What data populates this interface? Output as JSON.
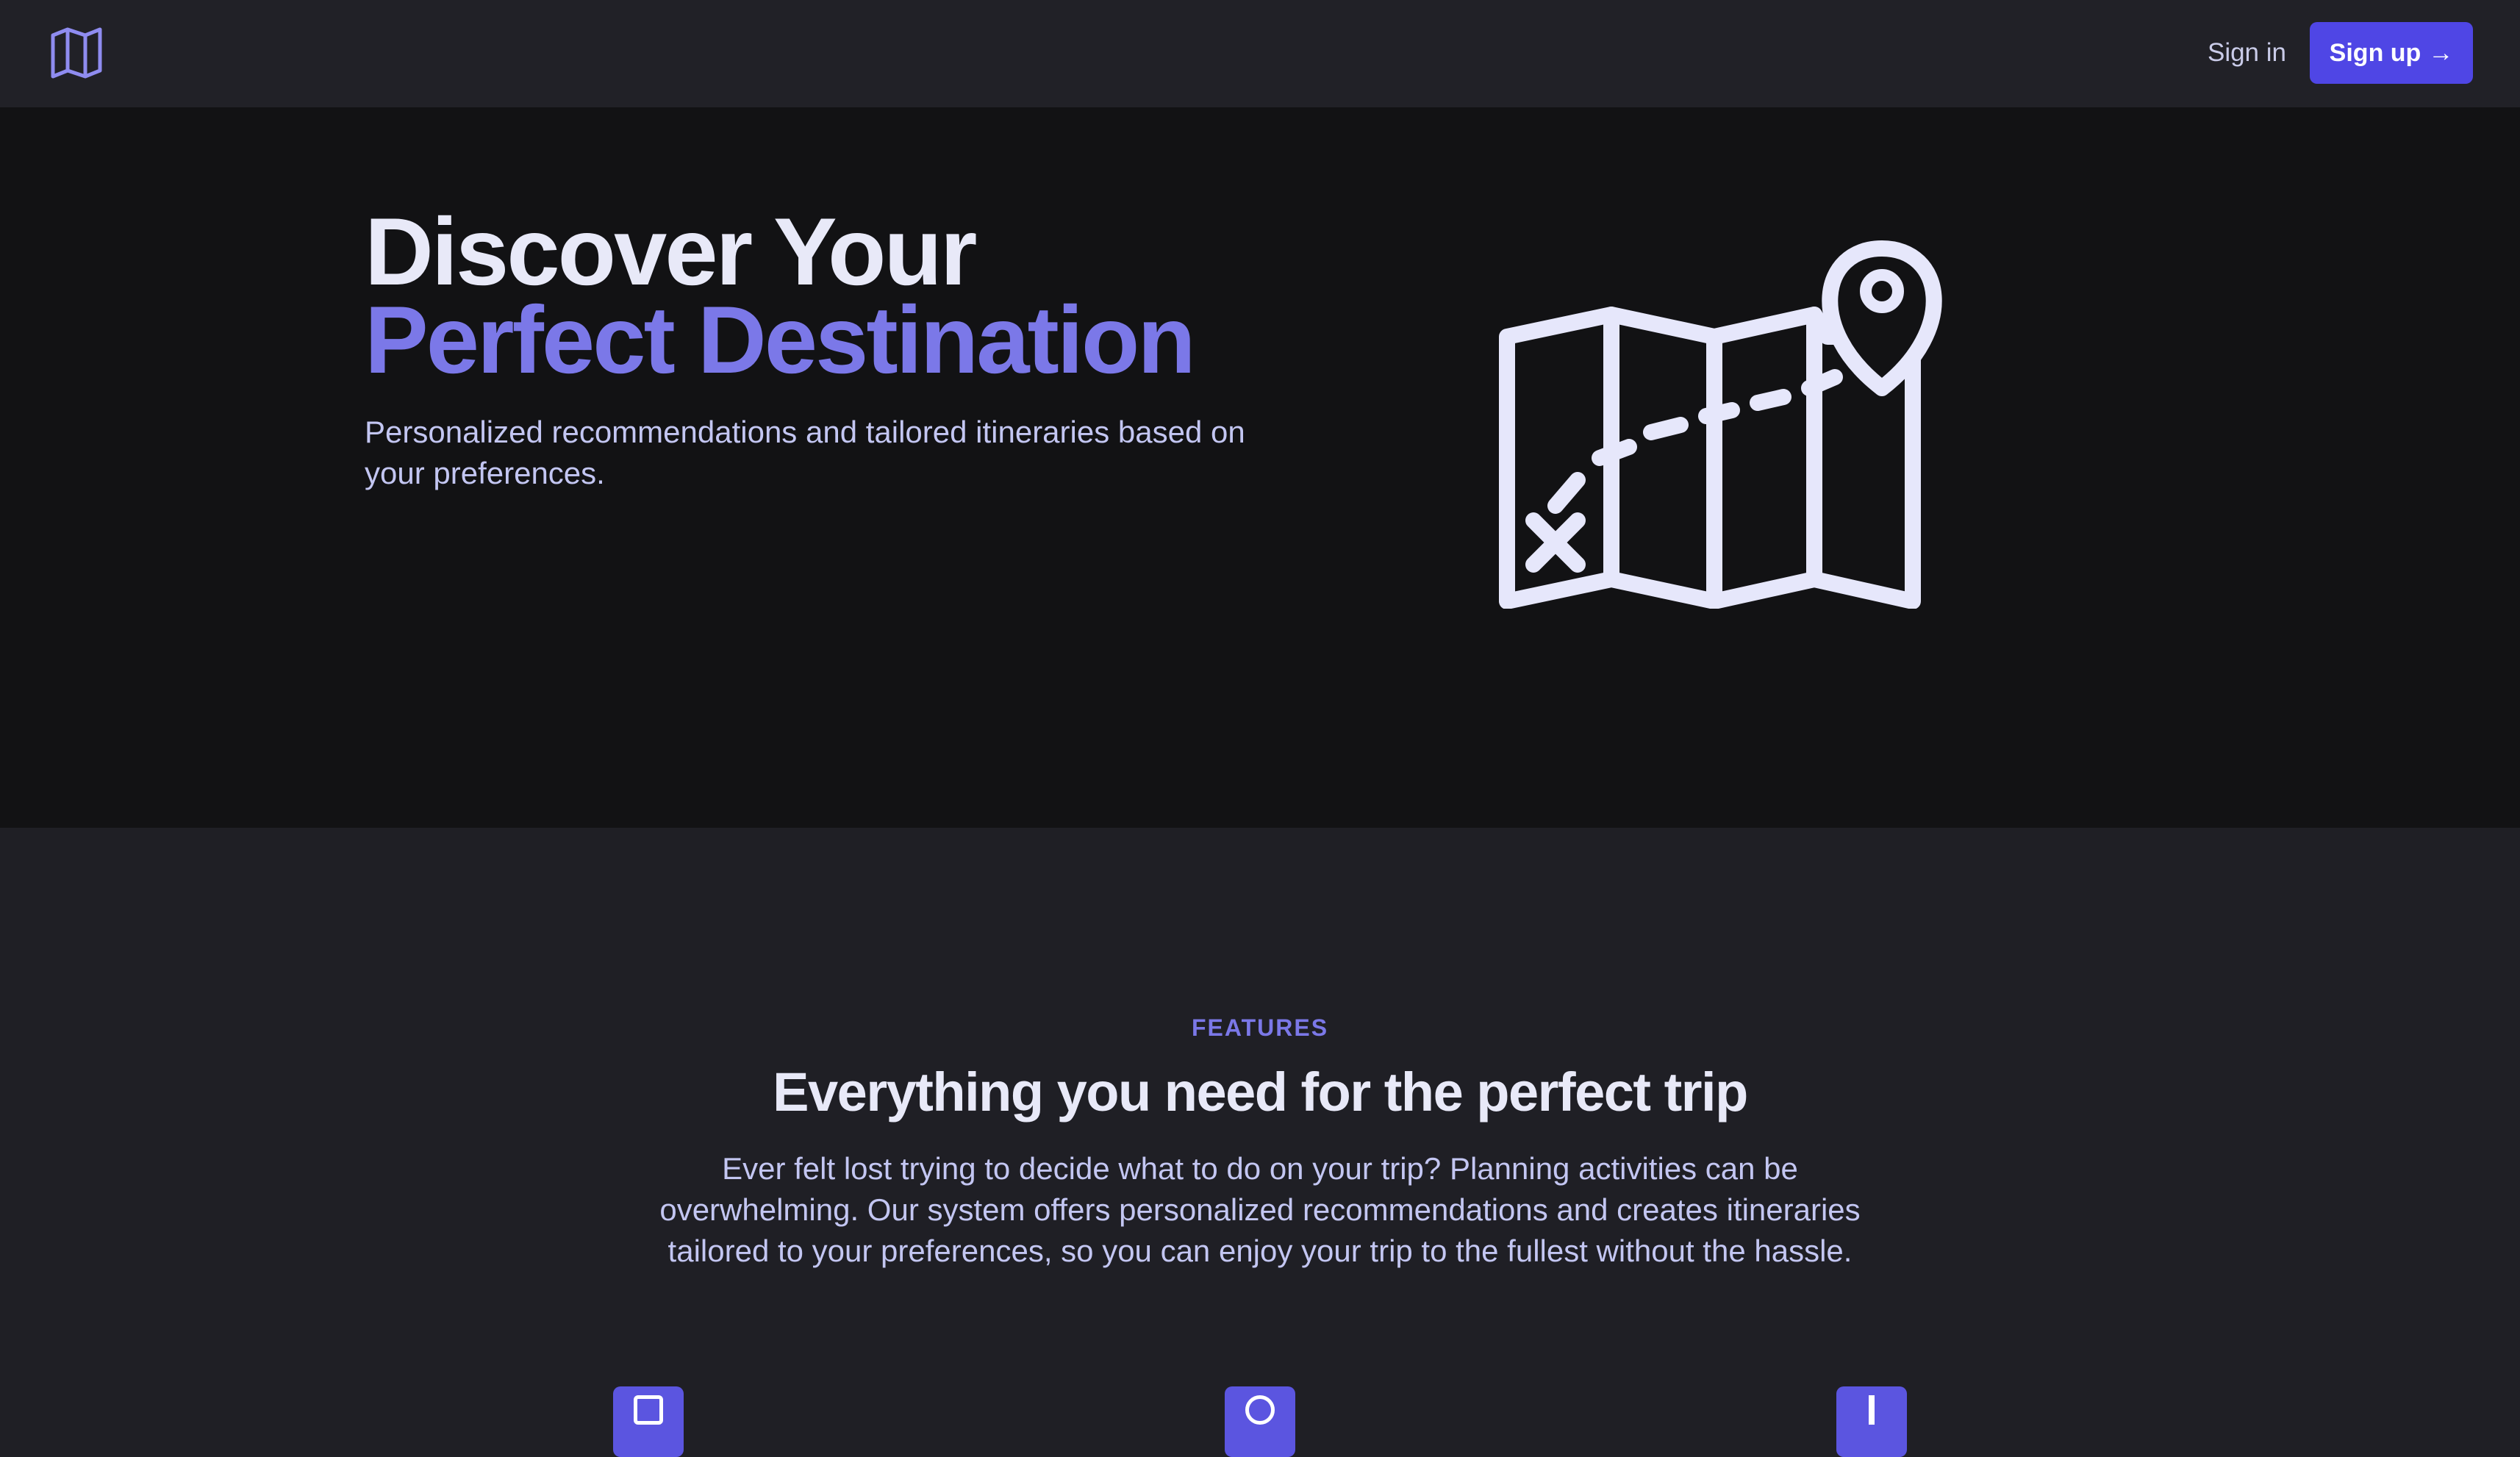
{
  "nav": {
    "logo_icon": "folded-map-icon",
    "signin_label": "Sign in",
    "signup_label": "Sign up",
    "signup_arrow": "→"
  },
  "hero": {
    "title_line1": "Discover Your",
    "title_line2": "Perfect Destination",
    "subtitle": "Personalized recommendations and tailored itineraries based on your preferences.",
    "illustration_icon": "treasure-map-pin-icon"
  },
  "features": {
    "eyebrow": "FEATURES",
    "title": "Everything you need for the perfect trip",
    "description": "Ever felt lost trying to decide what to do on your trip? Planning activities can be overwhelming. Our system offers personalized recommendations and creates itineraries tailored to your preferences, so you can enjoy your trip to the fullest without the hassle.",
    "cards": [
      {
        "icon": "feature-icon-1"
      },
      {
        "icon": "feature-icon-2"
      },
      {
        "icon": "feature-icon-3"
      }
    ]
  },
  "colors": {
    "accent": "#7b78e8",
    "button": "#4f46e5",
    "hero_bg": "#121214",
    "page_bg": "#1f1f25",
    "nav_bg": "#212127",
    "heading": "#e8e9f8",
    "body_text": "#c3c6f2"
  }
}
